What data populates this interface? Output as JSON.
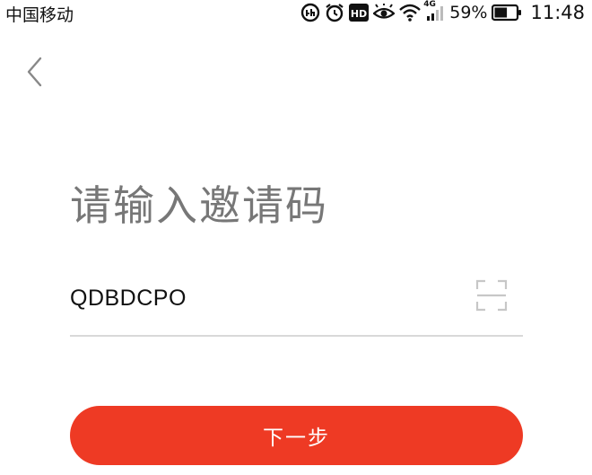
{
  "status_bar": {
    "carrier": "中国移动",
    "network_label": "4G",
    "battery_percent": "59%",
    "time": "11:48",
    "icons": [
      "data-saver-icon",
      "alarm-icon",
      "hd-icon",
      "eye-comfort-icon",
      "wifi-icon",
      "signal-icon",
      "battery-icon"
    ],
    "battery_level": 0.59
  },
  "header": {
    "back_icon": "chevron-left-icon"
  },
  "main": {
    "title": "请输入邀请码",
    "invite_code_value": "QDBDCPO",
    "scan_icon": "scan-frame-icon",
    "next_label": "下一步"
  },
  "colors": {
    "accent": "#ee3a24",
    "title_text": "#777777",
    "divider": "#d9d9d9"
  }
}
